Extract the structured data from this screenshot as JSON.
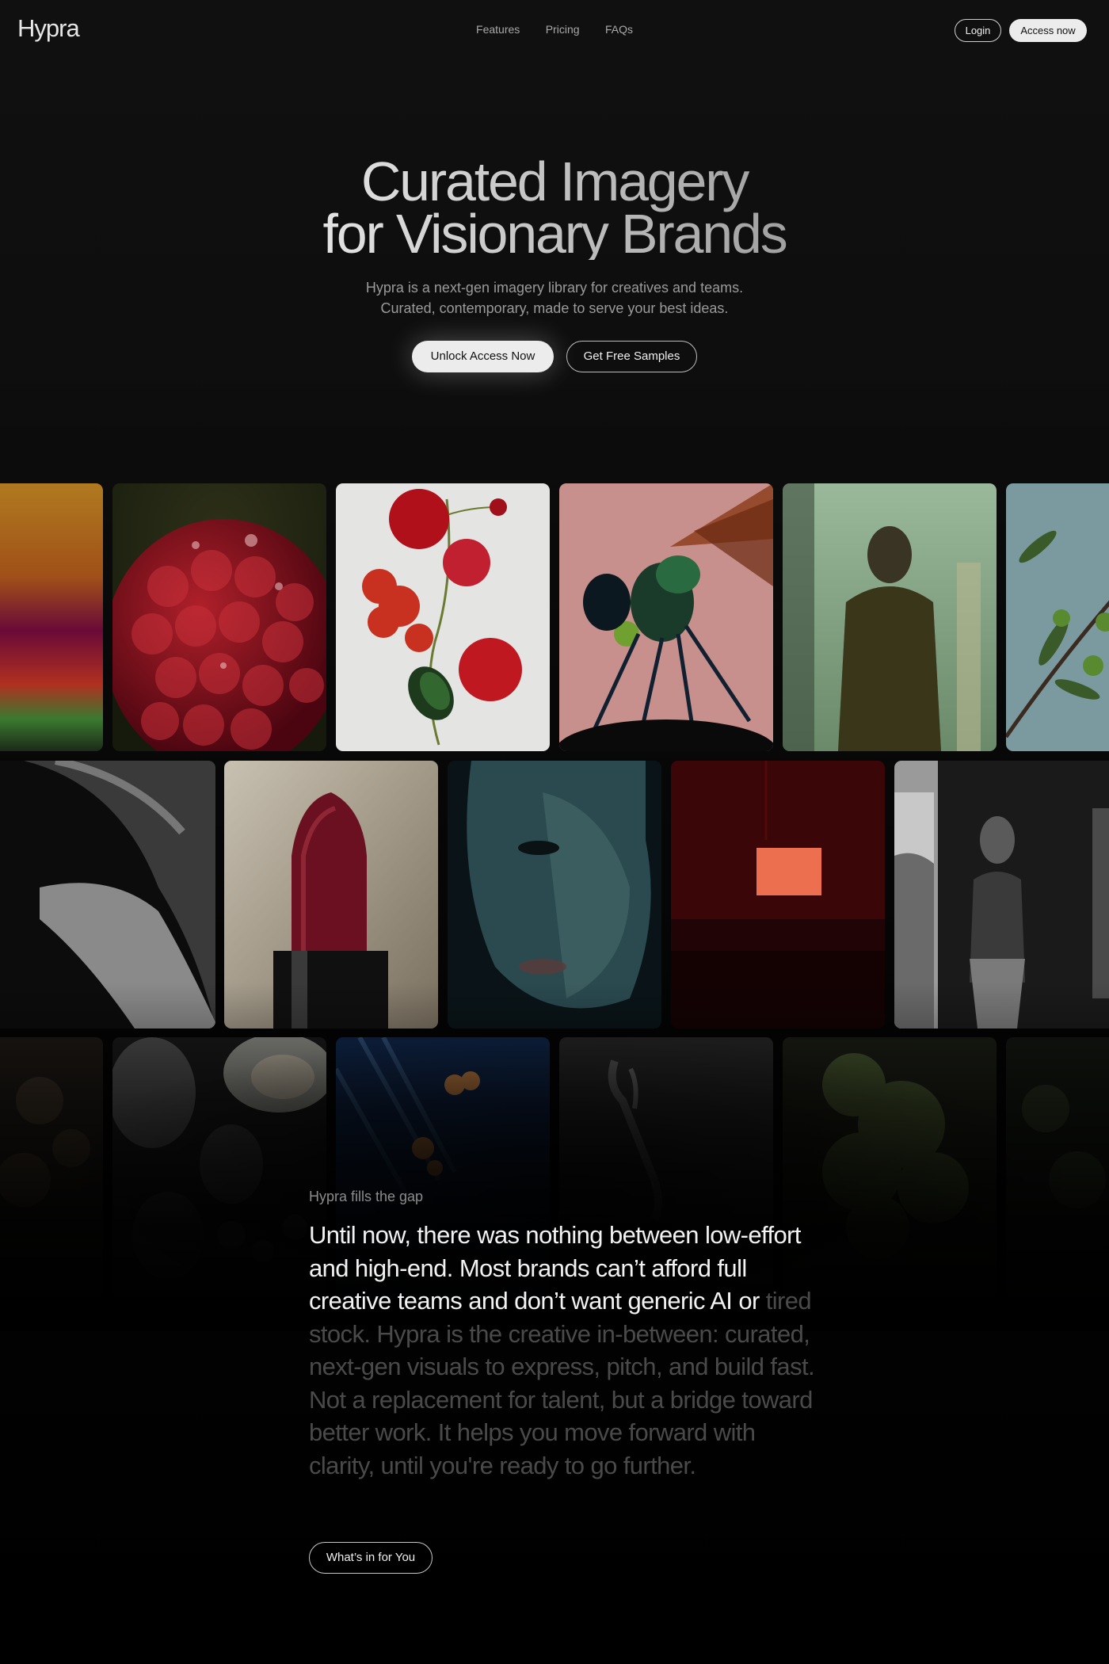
{
  "nav": {
    "logo": "Hypra",
    "links": [
      "Features",
      "Pricing",
      "FAQs"
    ],
    "login_label": "Login",
    "access_label": "Access now"
  },
  "hero": {
    "title_line1": "Curated Imagery",
    "title_line2": "for Visionary Brands",
    "subtitle_line1": "Hypra is a next-gen imagery library for creatives and teams.",
    "subtitle_line2": "Curated, contemporary, made to serve your best ideas.",
    "primary_cta": "Unlock Access Now",
    "secondary_cta": "Get Free Samples"
  },
  "gallery": {
    "row1": [
      "abstract-gradient",
      "red-raspberry",
      "cherries-and-beetle",
      "dragonfly",
      "blurred-figure",
      "olive-branch"
    ],
    "row2": [
      "shadowed-face",
      "red-lipstick",
      "teal-lit-face",
      "red-room-screen",
      "figure-by-window"
    ],
    "row3": [
      "dark-flowers",
      "oysters",
      "blue-flowers",
      "metal-clip",
      "green-bush",
      "dark-foliage"
    ]
  },
  "story": {
    "eyebrow": "Hypra fills the gap",
    "text_bright": "Until now, there was nothing between low-effort and high-end. Most brands can’t afford full creative teams and don’t want generic AI or ",
    "text_dim": "tired stock. Hypra is the creative in-between: curated, next-gen visuals to express, pitch, and build fast. Not a replacement for talent, but a bridge toward better work. It helps you move forward with clarity, until you're ready to go further.",
    "cta": "What’s in for You"
  },
  "colors": {
    "background": "#0e0e0e",
    "button_light": "#ececec",
    "text_dim": "#4a4a4a"
  }
}
